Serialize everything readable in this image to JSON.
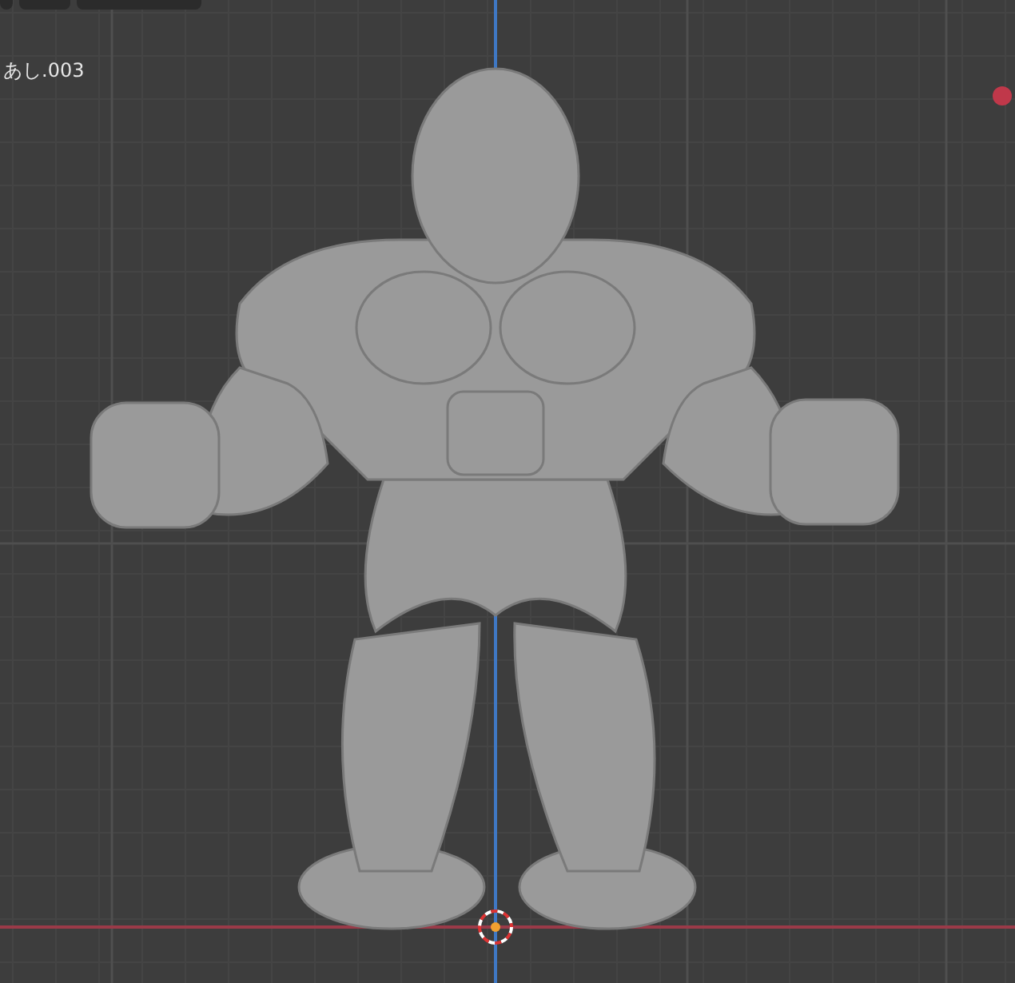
{
  "viewport": {
    "object_name": "あし.003"
  }
}
